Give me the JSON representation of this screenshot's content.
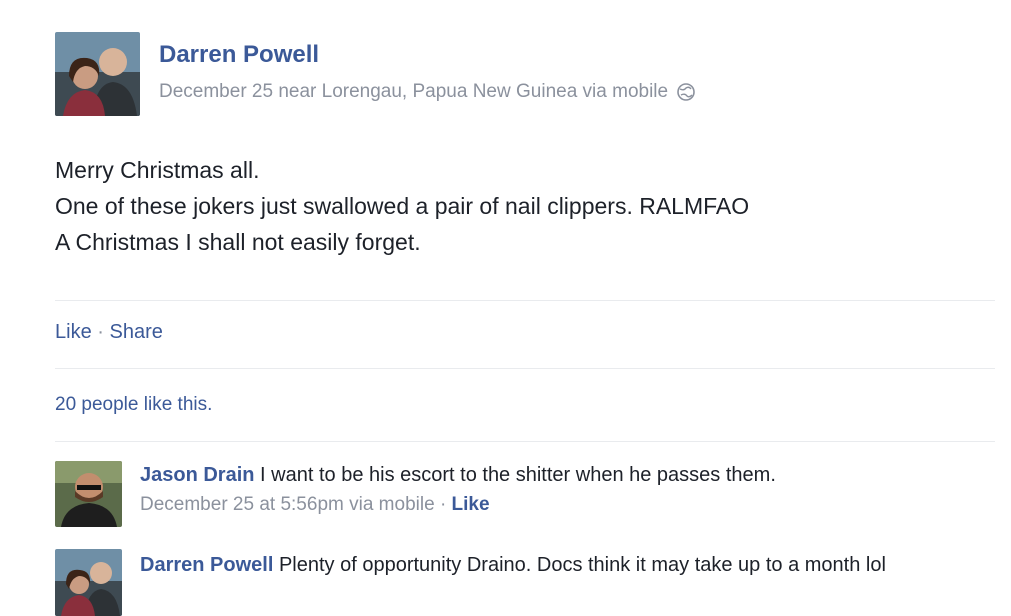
{
  "post": {
    "author": "Darren Powell",
    "meta": "December 25 near Lorengau, Papua New Guinea via mobile",
    "privacy_icon": "globe-icon",
    "lines": [
      "Merry Christmas all.",
      "One of these jokers just swallowed a pair of nail clippers. RALMFAO",
      "A Christmas I shall not easily forget."
    ],
    "actions": {
      "like": "Like",
      "separator": "·",
      "share": "Share"
    },
    "likes_summary": "20 people like this."
  },
  "comments": [
    {
      "author": "Jason Drain",
      "text": "I want to be his escort to the shitter when he passes them.",
      "meta": "December 25 at 5:56pm via mobile",
      "separator": "·",
      "like": "Like"
    },
    {
      "author": "Darren Powell",
      "text": "Plenty of opportunity Draino. Docs think it may take up to a month lol"
    }
  ],
  "colors": {
    "link": "#3b5998",
    "meta": "#8b919d",
    "text": "#1d2129",
    "divider": "#e9ebee"
  }
}
